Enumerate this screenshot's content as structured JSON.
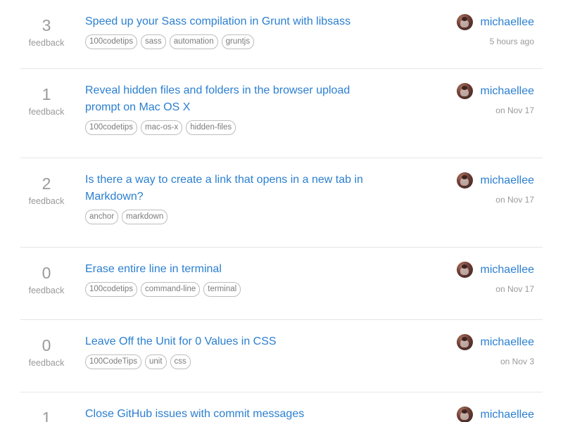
{
  "feedback_label": "feedback",
  "questions": [
    {
      "count": "3",
      "title_lines": [
        "Speed up your Sass compilation in Grunt with libsass"
      ],
      "tags": [
        "100codetips",
        "sass",
        "automation",
        "gruntjs"
      ],
      "author": "michaellee",
      "time": "5 hours ago"
    },
    {
      "count": "1",
      "title_lines": [
        "Reveal hidden files and folders in the browser upload",
        "prompt on Mac OS X"
      ],
      "tags": [
        "100codetips",
        "mac-os-x",
        "hidden-files"
      ],
      "author": "michaellee",
      "time": "on Nov 17"
    },
    {
      "count": "2",
      "title_lines": [
        "Is there a way to create a link that opens in a new tab in",
        "Markdown?"
      ],
      "tags": [
        "anchor",
        "markdown"
      ],
      "author": "michaellee",
      "time": "on Nov 17"
    },
    {
      "count": "0",
      "title_lines": [
        "Erase entire line in terminal"
      ],
      "tags": [
        "100codetips",
        "command-line",
        "terminal"
      ],
      "author": "michaellee",
      "time": "on Nov 17"
    },
    {
      "count": "0",
      "title_lines": [
        "Leave Off the Unit for 0 Values in CSS"
      ],
      "tags": [
        "100CodeTips",
        "unit",
        "css"
      ],
      "author": "michaellee",
      "time": "on Nov 3"
    },
    {
      "count": "1",
      "title_lines": [
        "Close GitHub issues with commit messages"
      ],
      "tags": [],
      "author": "michaellee",
      "time": ""
    }
  ]
}
